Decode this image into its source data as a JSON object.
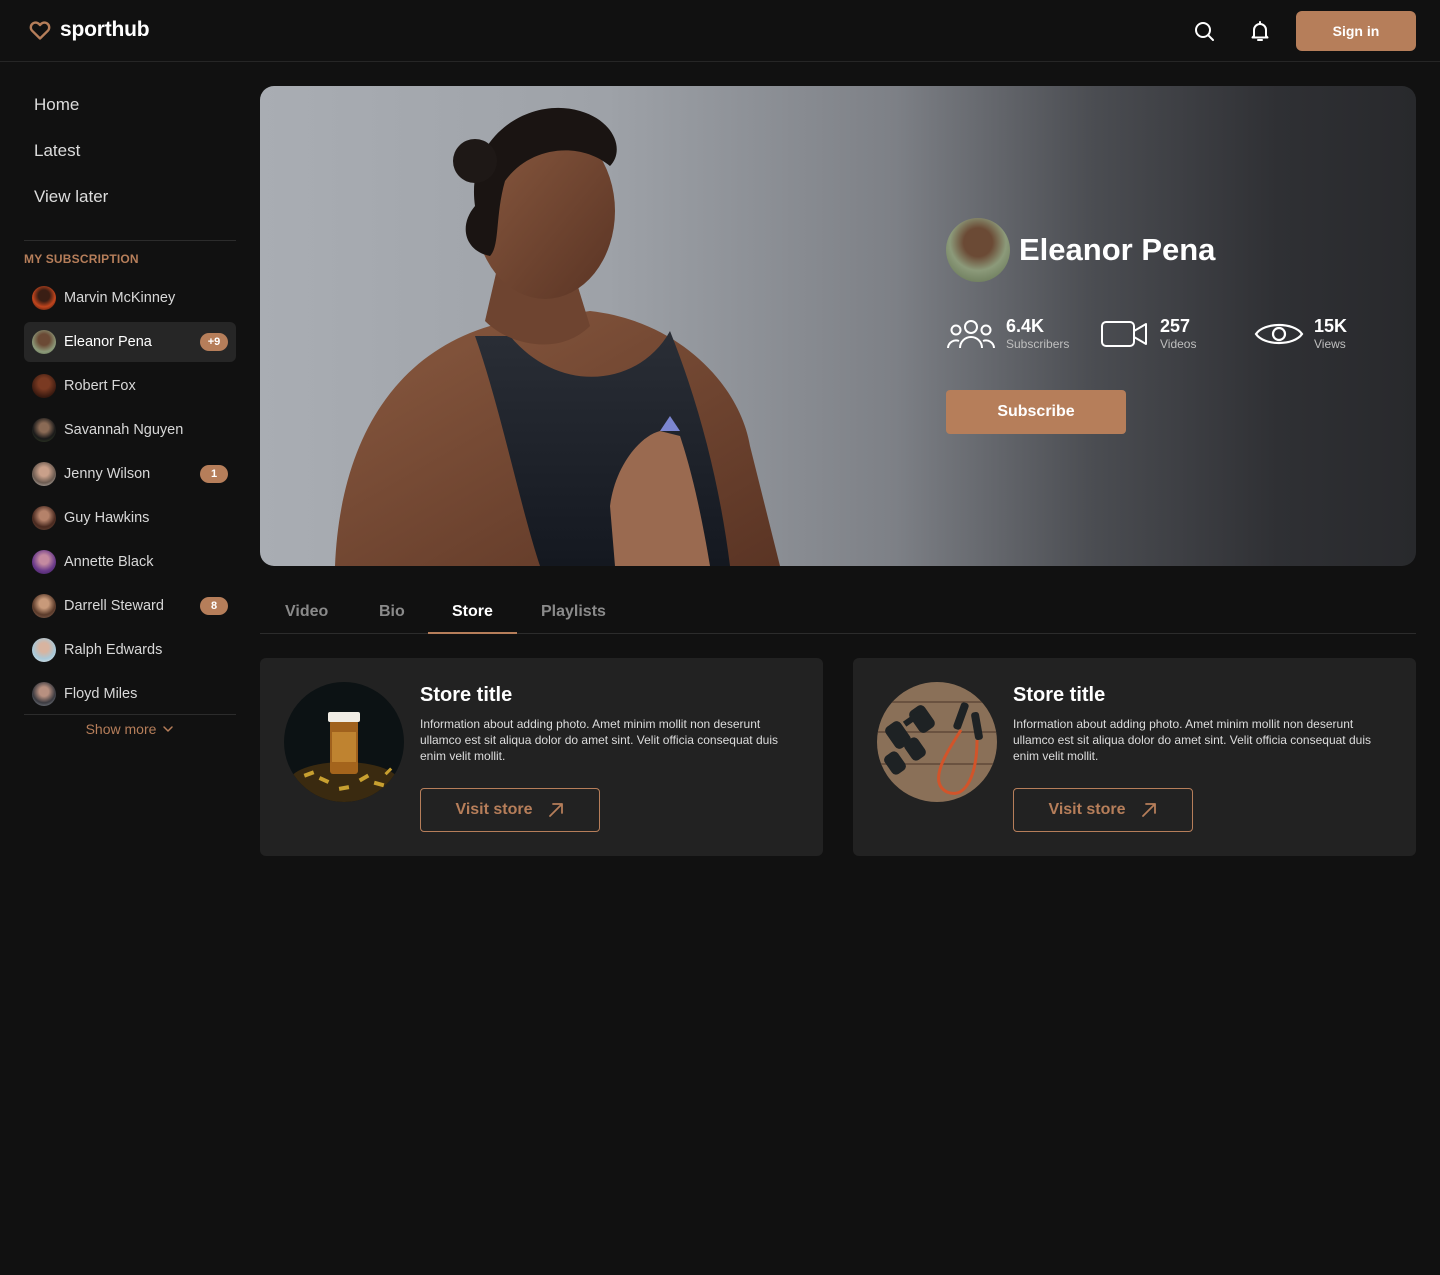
{
  "brand": {
    "name": "sporthub",
    "accent": "#b67e5a"
  },
  "header": {
    "sign_in_label": "Sign in",
    "icons": [
      "search-icon",
      "bell-icon"
    ]
  },
  "sidebar": {
    "nav": [
      {
        "label": "Home"
      },
      {
        "label": "Latest"
      },
      {
        "label": "View later"
      }
    ],
    "section_title": "MY SUBSCRIPTION",
    "subscriptions": [
      {
        "name": "Marvin McKinney",
        "badge": ""
      },
      {
        "name": "Eleanor Pena",
        "badge": "+9",
        "active": true
      },
      {
        "name": "Robert Fox",
        "badge": ""
      },
      {
        "name": "Savannah Nguyen",
        "badge": ""
      },
      {
        "name": "Jenny Wilson",
        "badge": "1"
      },
      {
        "name": "Guy Hawkins",
        "badge": ""
      },
      {
        "name": "Annette Black",
        "badge": ""
      },
      {
        "name": "Darrell Steward",
        "badge": "8"
      },
      {
        "name": "Ralph Edwards",
        "badge": ""
      },
      {
        "name": "Floyd Miles",
        "badge": ""
      }
    ],
    "show_more_label": "Show more"
  },
  "profile": {
    "name": "Eleanor Pena",
    "stats": [
      {
        "value": "6.4K",
        "label": "Subscribers",
        "icon": "users-icon"
      },
      {
        "value": "257",
        "label": "Videos",
        "icon": "video-camera-icon"
      },
      {
        "value": "15K",
        "label": "Views",
        "icon": "eye-icon"
      }
    ],
    "subscribe_label": "Subscribe"
  },
  "tabs": {
    "items": [
      {
        "label": "Video"
      },
      {
        "label": "Bio"
      },
      {
        "label": "Store",
        "active": true
      },
      {
        "label": "Playlists"
      }
    ]
  },
  "store": {
    "cards": [
      {
        "title": "Store title",
        "description": "Information about adding photo. Amet minim mollit non deserunt ullamco est sit aliqua dolor do amet sint. Velit officia consequat duis enim velit mollit.",
        "button_label": "Visit store",
        "image": "supplement-pills-photo"
      },
      {
        "title": "Store title",
        "description": "Information about adding photo. Amet minim mollit non deserunt ullamco est sit aliqua dolor do amet sint. Velit officia consequat duis enim velit mollit.",
        "button_label": "Visit store",
        "image": "dumbbells-jump-rope-photo"
      }
    ]
  }
}
